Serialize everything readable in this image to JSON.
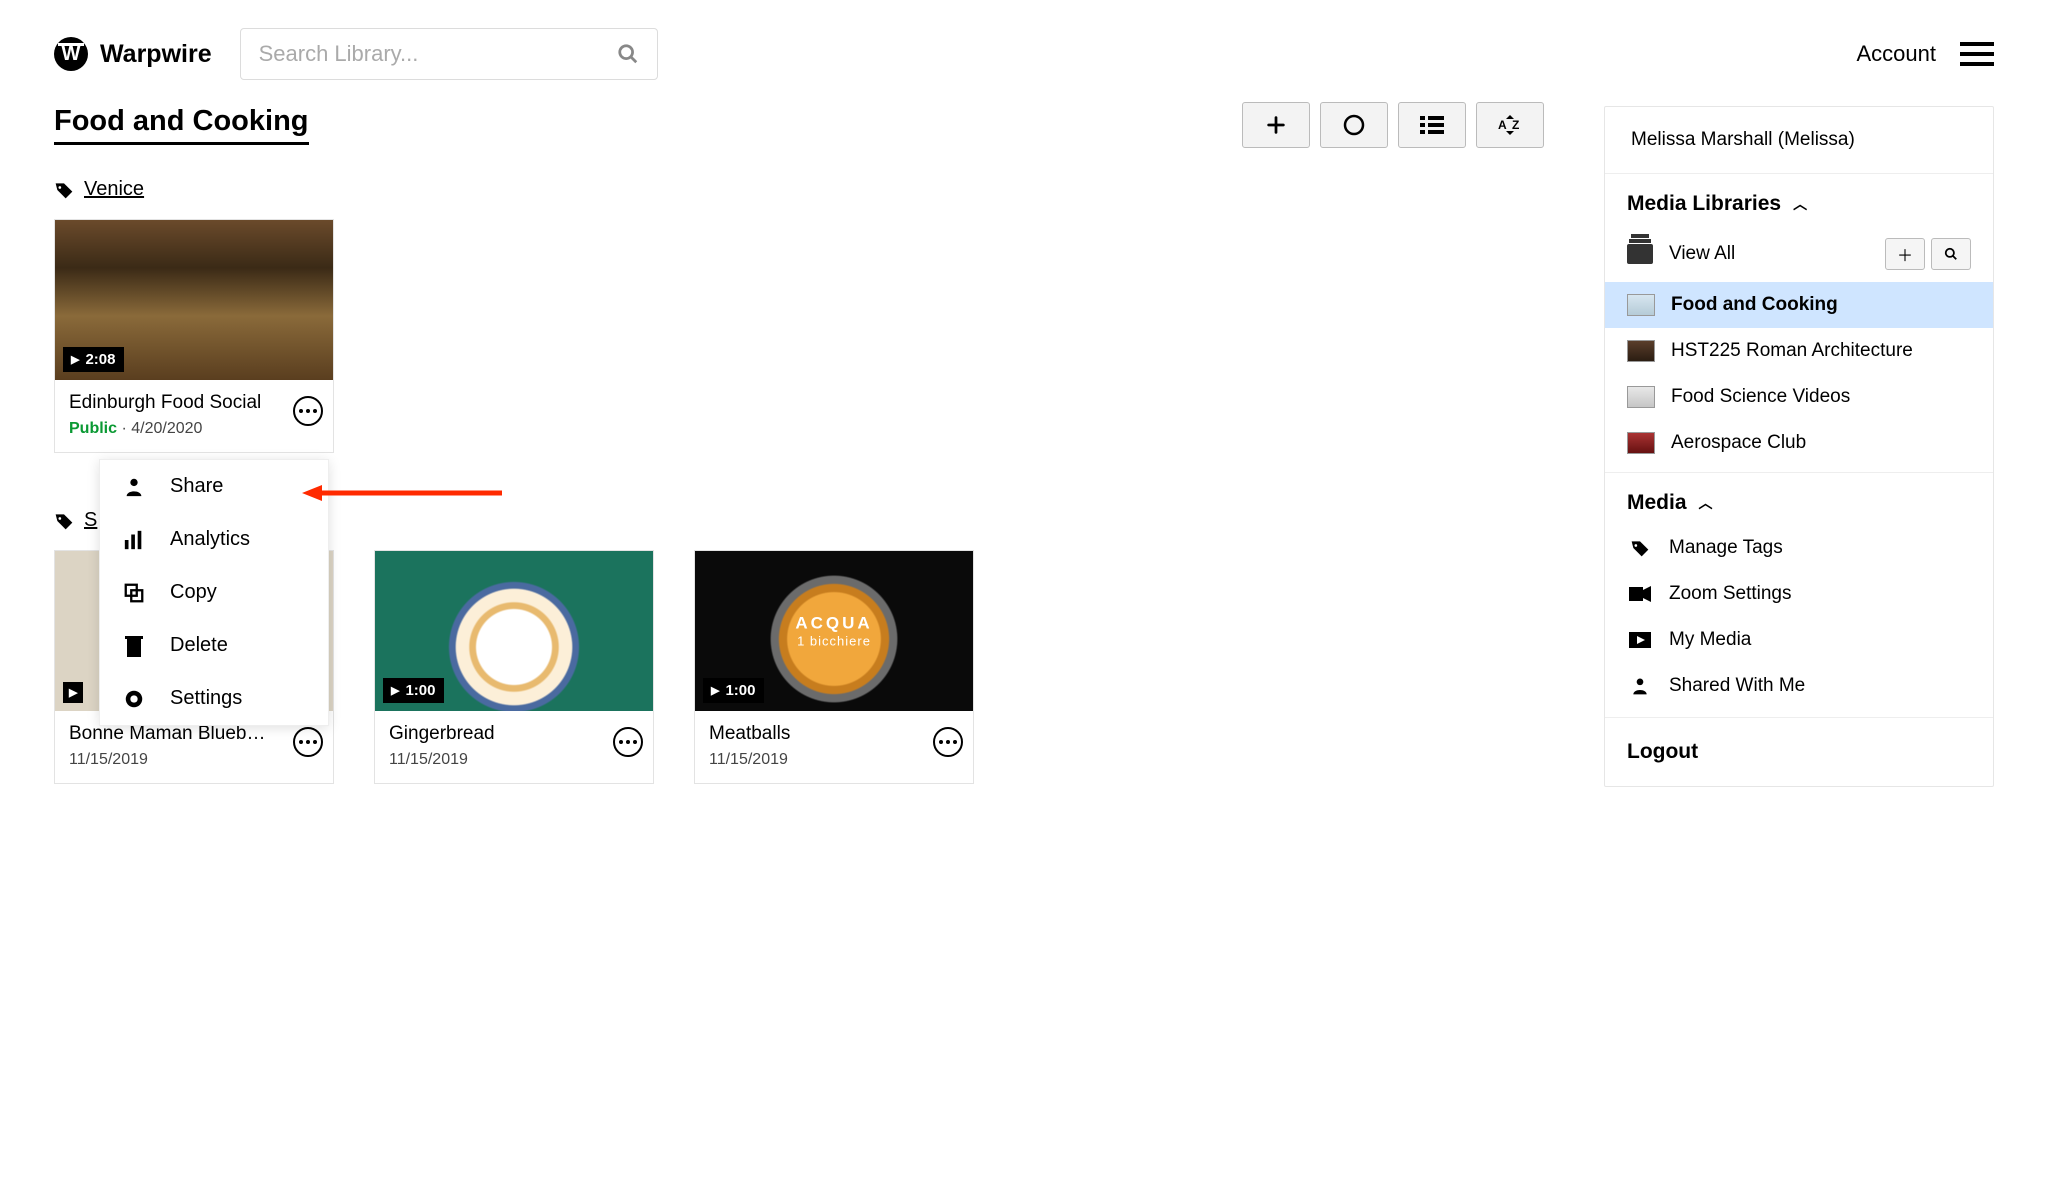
{
  "brand": "Warpwire",
  "search": {
    "placeholder": "Search Library..."
  },
  "header": {
    "account": "Account"
  },
  "page_title": "Food and Cooking",
  "tag": "Venice",
  "tag2": "S",
  "cards": [
    {
      "title": "Edinburgh Food Social",
      "duration": "2:08",
      "date": "4/20/2020",
      "public": "Public"
    },
    {
      "title": "Bonne Maman Blueb…",
      "duration": "",
      "date": "11/15/2019",
      "public": null
    },
    {
      "title": "Gingerbread",
      "duration": "1:00",
      "date": "11/15/2019",
      "public": null
    },
    {
      "title": "Meatballs",
      "duration": "1:00",
      "date": "11/15/2019",
      "public": null
    }
  ],
  "context_menu": {
    "share": "Share",
    "analytics": "Analytics",
    "copy": "Copy",
    "delete": "Delete",
    "settings": "Settings"
  },
  "sidebar": {
    "user": "Melissa Marshall (Melissa)",
    "libraries_heading": "Media Libraries",
    "view_all": "View All",
    "libraries": [
      {
        "name": "Food and Cooking",
        "active": true
      },
      {
        "name": "HST225 Roman Architecture",
        "active": false
      },
      {
        "name": "Food Science Videos",
        "active": false
      },
      {
        "name": "Aerospace Club",
        "active": false
      }
    ],
    "media_heading": "Media",
    "media": [
      {
        "name": "Manage Tags"
      },
      {
        "name": "Zoom Settings"
      },
      {
        "name": "My Media"
      },
      {
        "name": "Shared With Me"
      }
    ],
    "logout": "Logout"
  },
  "acqua": {
    "line1": "ACQUA",
    "line2": "1 bicchiere"
  }
}
